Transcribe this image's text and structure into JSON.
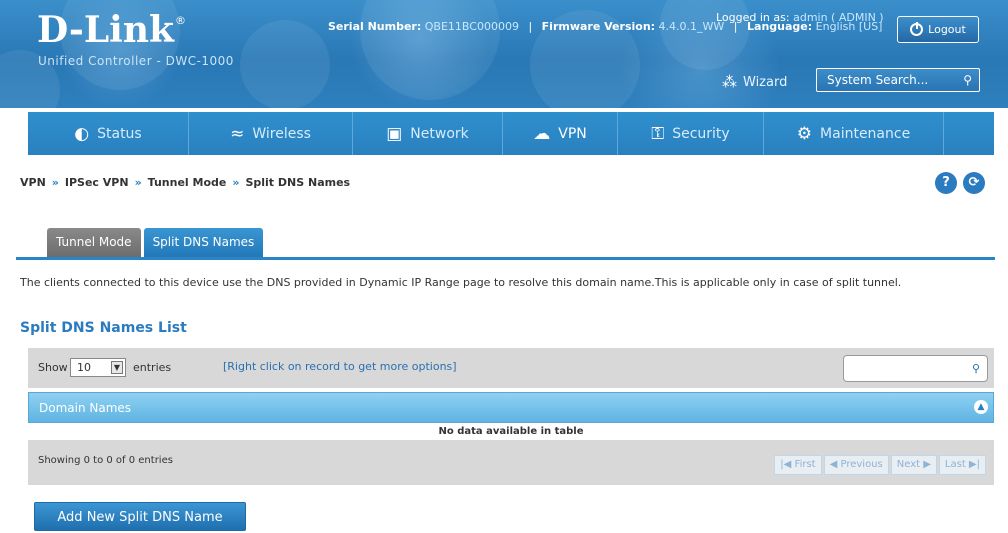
{
  "header": {
    "logo": "D-Link",
    "product": "Unified Controller - DWC-1000",
    "serial_label": "Serial Number:",
    "serial_value": "QBE11BC000009",
    "firmware_label": "Firmware Version:",
    "firmware_value": "4.4.0.1_WW",
    "language_label": "Language:",
    "language_value": "English [US]",
    "logged_label": "Logged in as:",
    "logged_value": "admin ( ADMIN )",
    "logout_label": "Logout",
    "wizard_label": "Wizard",
    "search_placeholder": "System Search..."
  },
  "nav": {
    "items": [
      {
        "label": "Status",
        "icon": "dashboard-icon"
      },
      {
        "label": "Wireless",
        "icon": "wifi-icon"
      },
      {
        "label": "Network",
        "icon": "monitor-icon"
      },
      {
        "label": "VPN",
        "icon": "cloud-lock-icon"
      },
      {
        "label": "Security",
        "icon": "lock-icon"
      },
      {
        "label": "Maintenance",
        "icon": "gears-icon"
      }
    ]
  },
  "breadcrumb": {
    "items": [
      "VPN",
      "IPSec VPN",
      "Tunnel Mode",
      "Split DNS Names"
    ],
    "separator": "»"
  },
  "tabs": [
    {
      "label": "Tunnel Mode"
    },
    {
      "label": "Split DNS Names"
    }
  ],
  "description": "The clients connected to this device use the DNS provided in Dynamic IP Range page to resolve this domain name.This is applicable only in case of split tunnel.",
  "section_title": "Split DNS Names List",
  "table": {
    "show_label": "Show",
    "page_size": "10",
    "entries_label": "entries",
    "hint": "[Right click on record to get more options]",
    "column": "Domain Names",
    "empty_text": "No data available in table",
    "info": "Showing 0 to 0 of 0 entries",
    "pager": {
      "first": "First",
      "previous": "Previous",
      "next": "Next",
      "last": "Last"
    }
  },
  "add_button": "Add New Split DNS Name"
}
